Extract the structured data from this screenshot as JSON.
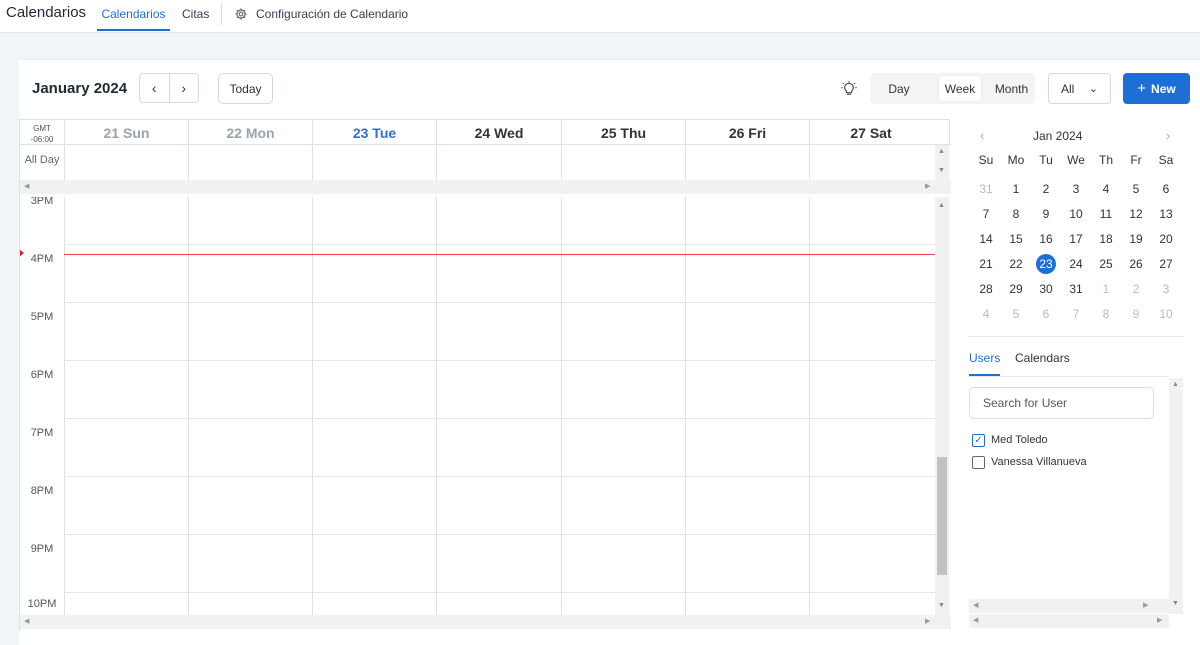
{
  "app": {
    "title": "Calendarios"
  },
  "nav": {
    "tabs": [
      {
        "label": "Calendarios",
        "active": true
      },
      {
        "label": "Citas",
        "active": false
      }
    ],
    "settings_label": "Configuración de Calendario"
  },
  "toolbar": {
    "month_title": "January 2024",
    "today_label": "Today",
    "views": [
      "Day",
      "Week",
      "Month"
    ],
    "active_view": "Week",
    "filter_value": "All",
    "new_label": "New"
  },
  "week": {
    "timezone_line1": "GMT",
    "timezone_line2": "-06:00",
    "all_day_label": "All Day",
    "days": [
      {
        "label": "21 Sun",
        "state": "past"
      },
      {
        "label": "22 Mon",
        "state": "past"
      },
      {
        "label": "23 Tue",
        "state": "today"
      },
      {
        "label": "24 Wed",
        "state": "future"
      },
      {
        "label": "25 Thu",
        "state": "future"
      },
      {
        "label": "26 Fri",
        "state": "future"
      },
      {
        "label": "27 Sat",
        "state": "future"
      }
    ],
    "hours": [
      "3PM",
      "4PM",
      "5PM",
      "6PM",
      "7PM",
      "8PM",
      "9PM",
      "10PM"
    ]
  },
  "mini_calendar": {
    "month_label": "Jan 2024",
    "weekdays": [
      "Su",
      "Mo",
      "Tu",
      "We",
      "Th",
      "Fr",
      "Sa"
    ],
    "weeks": [
      [
        "31",
        "1",
        "2",
        "3",
        "4",
        "5",
        "6"
      ],
      [
        "7",
        "8",
        "9",
        "10",
        "11",
        "12",
        "13"
      ],
      [
        "14",
        "15",
        "16",
        "17",
        "18",
        "19",
        "20"
      ],
      [
        "21",
        "22",
        "23",
        "24",
        "25",
        "26",
        "27"
      ],
      [
        "28",
        "29",
        "30",
        "31",
        "1",
        "2",
        "3"
      ],
      [
        "4",
        "5",
        "6",
        "7",
        "8",
        "9",
        "10"
      ]
    ],
    "selected": "23"
  },
  "side_panel": {
    "tabs": [
      "Users",
      "Calendars"
    ],
    "active_tab": "Users",
    "search_placeholder": "Search for User",
    "users": [
      {
        "name": "Med Toledo",
        "checked": true
      },
      {
        "name": "Vanessa Villanueva",
        "checked": false
      }
    ]
  },
  "colors": {
    "accent": "#1d6fd6",
    "today_text": "#2f6fcf",
    "now_line": "#e54b4b"
  }
}
